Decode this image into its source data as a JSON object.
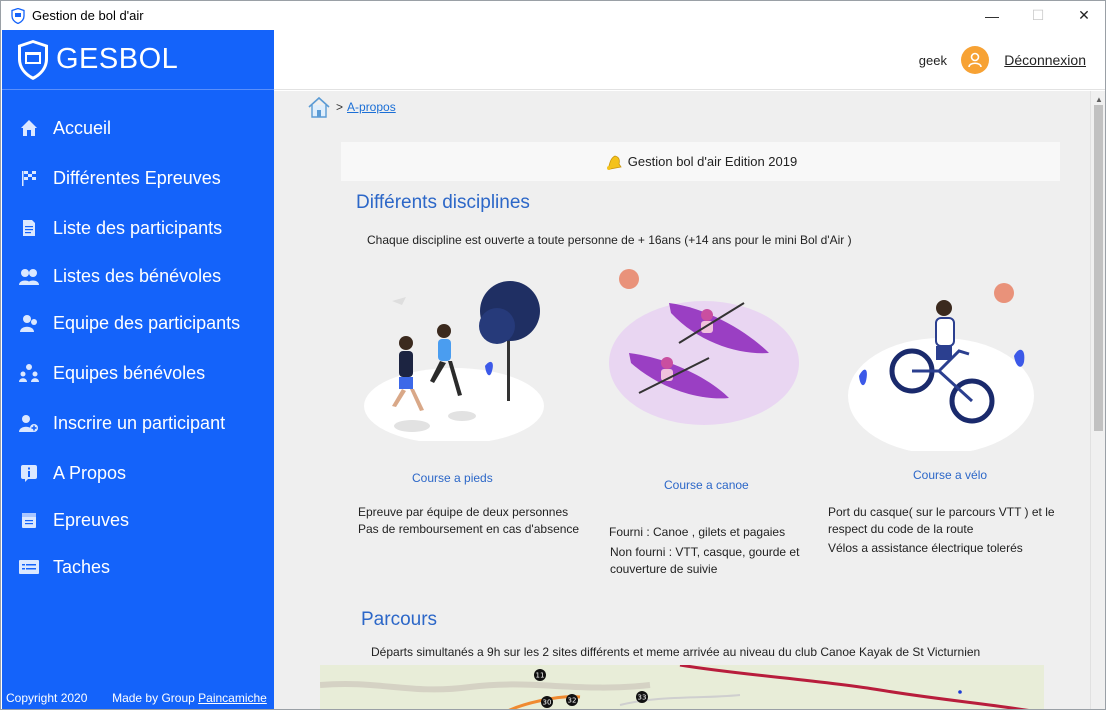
{
  "window": {
    "title": "Gestion de bol d'air",
    "controls": {
      "minimize": "—",
      "maximize": "☐",
      "close": "✕"
    }
  },
  "sidebar": {
    "brand": "GESBOL",
    "items": [
      {
        "label": "Accueil",
        "icon": "home-icon"
      },
      {
        "label": "Différentes Epreuves",
        "icon": "checkered-flag-icon"
      },
      {
        "label": "Liste des participants",
        "icon": "document-icon"
      },
      {
        "label": "Listes des bénévoles",
        "icon": "volunteers-icon"
      },
      {
        "label": "Equipe des participants",
        "icon": "team-icon"
      },
      {
        "label": "Equipes bénévoles",
        "icon": "volunteer-team-icon"
      },
      {
        "label": "Inscrire un participant",
        "icon": "add-user-icon"
      },
      {
        "label": "A Propos",
        "icon": "info-icon"
      },
      {
        "label": "Epreuves",
        "icon": "calendar-icon"
      },
      {
        "label": "Taches",
        "icon": "tasks-icon"
      }
    ],
    "footer": {
      "copyright": "Copyright 2020",
      "made_by": "Made by Group",
      "group_link": "Paincamiche"
    }
  },
  "header": {
    "username": "geek",
    "logout": "Déconnexion"
  },
  "breadcrumb": {
    "separator": ">",
    "current": "A-propos"
  },
  "main": {
    "banner": "Gestion bol d'air Edition 2019",
    "disciplines_title": "Différents disciplines",
    "disciplines_intro": "Chaque discipline est ouverte a toute personne de + 16ans (+14 ans pour le mini Bol d'Air )",
    "disciplines": [
      {
        "caption": "Course a pieds",
        "lines": [
          "Epreuve par équipe de deux personnes",
          "Pas de remboursement en cas d'absence"
        ]
      },
      {
        "caption": "Course a canoe",
        "lines": [
          "Fourni : Canoe , gilets et pagaies",
          "Non fourni : VTT, casque, gourde et",
          "couverture de suivie"
        ]
      },
      {
        "caption": "Course a vélo",
        "lines": [
          "Port du casque( sur le parcours VTT ) et le",
          "respect du code de la route",
          "Vélos a assistance électrique tolerés"
        ]
      }
    ],
    "parcours_title": "Parcours",
    "parcours_text": "Départs simultanés a 9h sur les 2 sites différents et meme arrivée au niveau du club Canoe Kayak de St Victurnien",
    "map_markers": [
      "11",
      "30",
      "32",
      "33"
    ]
  },
  "colors": {
    "sidebar": "#1463fa",
    "accent_text": "#2c67c8",
    "avatar": "#f7a234",
    "content_bg": "#efefef"
  }
}
